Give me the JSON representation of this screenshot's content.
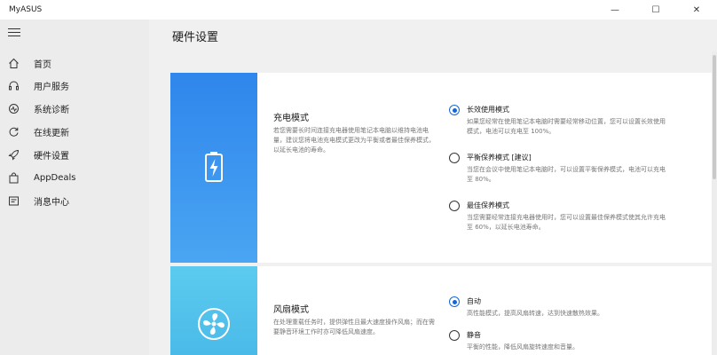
{
  "window": {
    "title": "MyASUS",
    "minimize": "—",
    "maximize": "☐",
    "close": "✕"
  },
  "sidebar": {
    "items": [
      {
        "label": "首页",
        "icon": "home-icon"
      },
      {
        "label": "用户服务",
        "icon": "headset-icon"
      },
      {
        "label": "系统诊断",
        "icon": "diagnostics-icon"
      },
      {
        "label": "在线更新",
        "icon": "refresh-icon"
      },
      {
        "label": "硬件设置",
        "icon": "rocket-icon"
      },
      {
        "label": "AppDeals",
        "icon": "bag-icon"
      },
      {
        "label": "消息中心",
        "icon": "message-icon"
      }
    ],
    "active_index": 4
  },
  "main": {
    "title": "硬件设置",
    "charging": {
      "title": "充电模式",
      "description": "若您需要长时间连接充电器使用笔记本电脑以维持电池电量，建议您将电池充电模式更改为平衡或者最佳保养模式，以延长电池的寿命。",
      "options": [
        {
          "title": "长效使用模式",
          "description": "如果您经常在使用笔记本电脑时需要经常移动位置，您可以设置长效使用模式，电池可以充电至 100%。",
          "selected": true
        },
        {
          "title": "平衡保养模式 [建议]",
          "description": "当您在会议中使用笔记本电脑时，可以设置平衡保养模式，电池可以充电至 80%。",
          "selected": false
        },
        {
          "title": "最佳保养模式",
          "description": "当您需要经常连接充电器使用时，您可以设置最佳保养模式使其允许充电至 60%，以延长电池寿命。",
          "selected": false
        }
      ]
    },
    "fan": {
      "title": "风扇模式",
      "description": "在处理重载任务时，提供弹性且最大速度操作风扇；而在需要静音环境工作时亦可降低风扇速度。",
      "options": [
        {
          "title": "自动",
          "description": "高性能模式，提高风扇转速，达到快速散热效果。",
          "selected": true
        },
        {
          "title": "静音",
          "description": "平衡的性能，降低风扇旋转速度和音量。",
          "selected": false
        }
      ]
    }
  },
  "colors": {
    "accent": "#1565d8",
    "charging_banner": "#3a93ee",
    "fan_banner": "#55c4ee"
  }
}
